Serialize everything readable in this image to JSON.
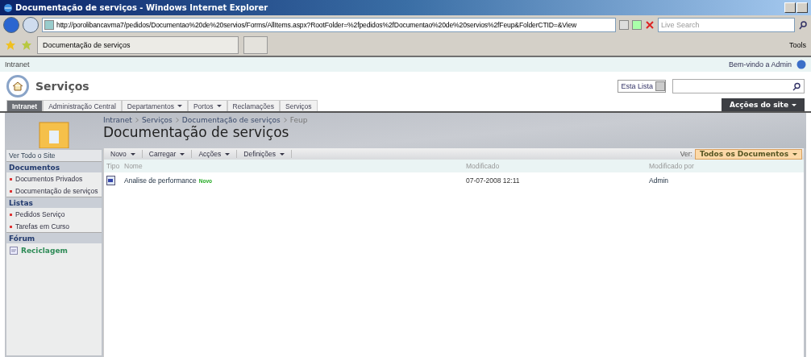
{
  "browser": {
    "title": "Documentação de serviços - Windows Internet Explorer",
    "address": "http://porolibancavma7/pedidos/Documentao%20de%20servios/Forms/AllItems.aspx?RootFolder=%2fpedidos%2fDocumentao%20de%20servios%2fFeup&FolderCTID=&View",
    "search_placeholder": "Live Search",
    "tab": "Documentação de serviços",
    "tools": "Tools"
  },
  "top_strip": {
    "site": "Intranet",
    "welcome": "Bem-vindo a Admin"
  },
  "site": {
    "title": "Serviços",
    "scope": "Esta Lista"
  },
  "nav": [
    {
      "label": "Intranet",
      "selected": true,
      "menu": false
    },
    {
      "label": "Administração Central",
      "selected": false,
      "menu": false
    },
    {
      "label": "Departamentos",
      "selected": false,
      "menu": true
    },
    {
      "label": "Portos",
      "selected": false,
      "menu": true
    },
    {
      "label": "Reclamações",
      "selected": false,
      "menu": false
    },
    {
      "label": "Serviços",
      "selected": false,
      "menu": false
    }
  ],
  "site_actions": "Acções do site",
  "breadcrumb": [
    "Intranet",
    "Serviços",
    "Documentação de serviços",
    "Feup"
  ],
  "page_title": "Documentação de serviços",
  "sidebar": {
    "view_all": "Ver Todo o Site",
    "sections": [
      {
        "heading": "Documentos",
        "items": [
          {
            "label": "Documentos Privados",
            "kind": "link"
          },
          {
            "label": "Documentação de serviços",
            "kind": "link"
          }
        ]
      },
      {
        "heading": "Listas",
        "items": [
          {
            "label": "Pedidos Serviço",
            "kind": "link"
          },
          {
            "label": "Tarefas em Curso",
            "kind": "link"
          }
        ]
      },
      {
        "heading": "Fórum",
        "items": [
          {
            "label": "Reciclagem",
            "kind": "discussion"
          }
        ]
      }
    ]
  },
  "toolbar": {
    "menus": [
      "Novo",
      "Carregar",
      "Acções",
      "Definições"
    ],
    "view_label": "Ver:",
    "view": "Todos os Documentos"
  },
  "table": {
    "columns": [
      "Tipo",
      "Nome",
      "Modificado",
      "Modificado por"
    ],
    "rows": [
      {
        "name": "Analise de performance",
        "badge": "Novo",
        "modified": "07-07-2008 12:11",
        "modified_by": "Admin"
      }
    ]
  }
}
